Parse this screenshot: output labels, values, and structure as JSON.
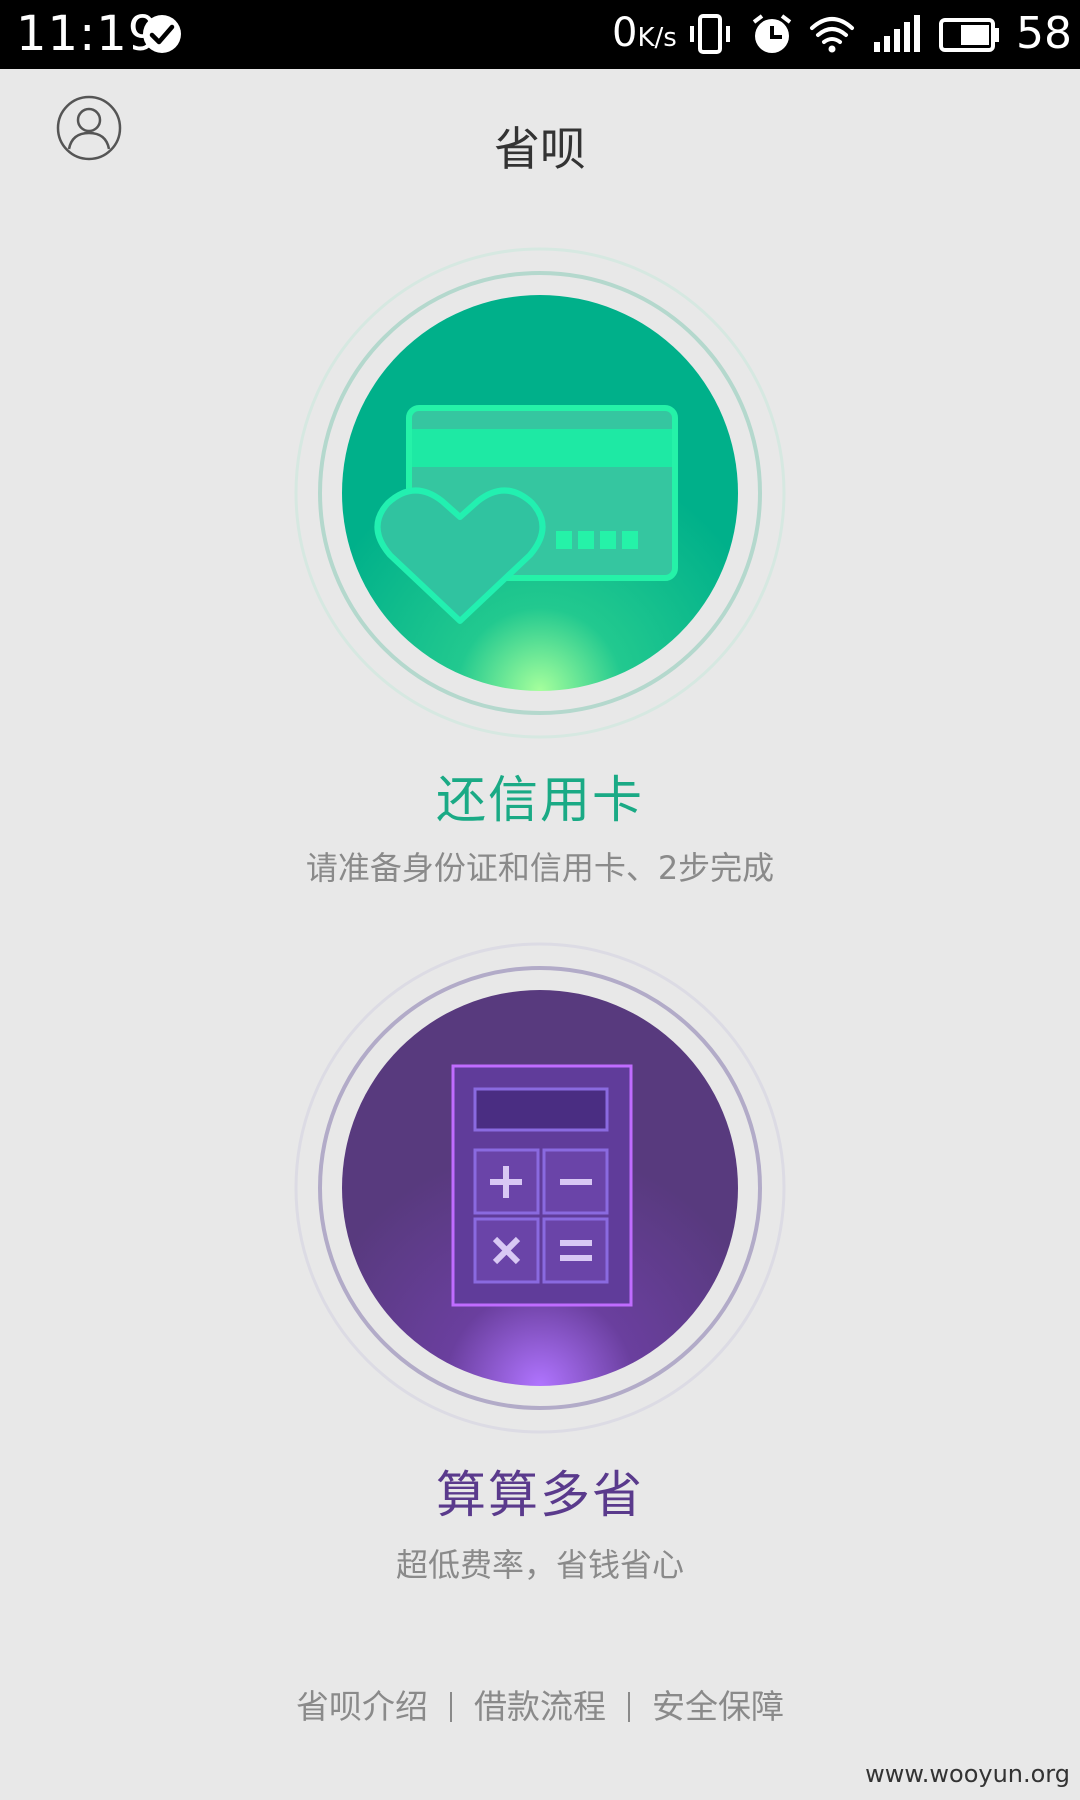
{
  "status_bar": {
    "time": "11:19",
    "net_speed": "0",
    "net_unit": "K/s",
    "battery": "58",
    "icons": [
      "check-circle-icon",
      "vibrate-icon",
      "alarm-icon",
      "wifi-icon",
      "signal-icon",
      "battery-icon"
    ]
  },
  "header": {
    "title": "省呗",
    "avatar_icon": "user-profile-icon"
  },
  "features": [
    {
      "title": "还信用卡",
      "subtitle": "请准备身份证和信用卡、2步完成",
      "icon": "credit-card-heart-icon",
      "color": "#1aaa85"
    },
    {
      "title": "算算多省",
      "subtitle": "超低费率，省钱省心",
      "icon": "calculator-icon",
      "color": "#5a3a8c"
    }
  ],
  "footer": {
    "links": [
      "省呗介绍",
      "借款流程",
      "安全保障"
    ]
  },
  "watermark": "www.wooyun.org"
}
